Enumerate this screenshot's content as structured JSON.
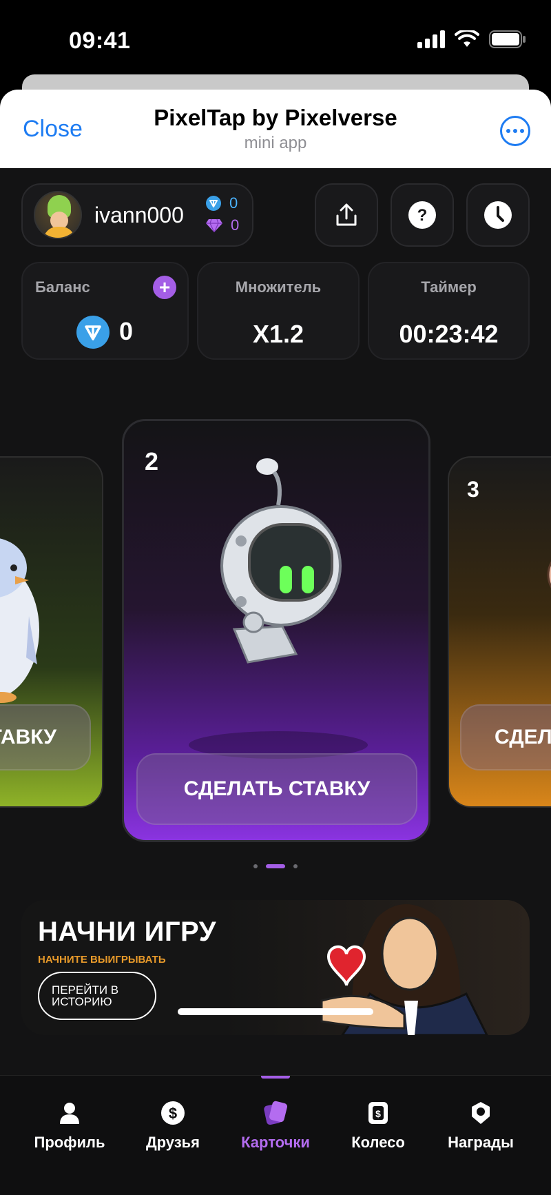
{
  "status_bar": {
    "time": "09:41"
  },
  "header": {
    "close_label": "Close",
    "title": "PixelTap by Pixelverse",
    "subtitle": "mini app"
  },
  "user": {
    "name": "ivann000",
    "ton_count": "0",
    "gem_count": "0"
  },
  "stats": [
    {
      "label": "Баланс",
      "value": "0"
    },
    {
      "label": "Множитель",
      "value": "X1.2"
    },
    {
      "label": "Таймер",
      "value": "00:23:42"
    }
  ],
  "cards": {
    "left": {
      "bet_label": "ТАВКУ"
    },
    "center": {
      "number": "2",
      "bet_label": "СДЕЛАТЬ СТАВКУ"
    },
    "right": {
      "number": "3",
      "bet_label": "СДЕЛА"
    }
  },
  "promo": {
    "title": "НАЧНИ ИГРУ",
    "subtitle": "НАЧНИТЕ ВЫИГРЫВАТЬ",
    "button_line1": "ПЕРЕЙТИ В",
    "button_line2": "ИСТОРИЮ"
  },
  "nav": {
    "profile": "Профиль",
    "friends": "Друзья",
    "cards": "Карточки",
    "wheel": "Колесо",
    "rewards": "Награды"
  },
  "colors": {
    "accent": "#a45ee6",
    "ios_blue": "#1e7cf2",
    "ton_blue": "#3aa0e8",
    "promo_orange": "#e89a2a"
  }
}
